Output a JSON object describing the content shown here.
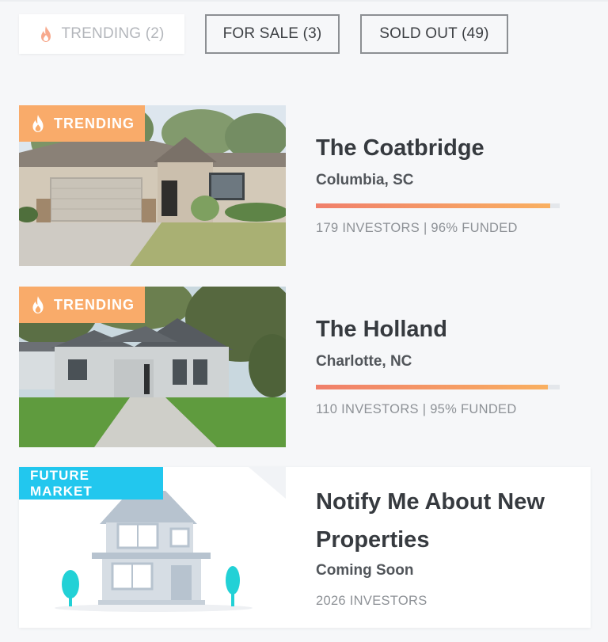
{
  "tabs": [
    {
      "label": "TRENDING (2)",
      "icon": "flame-icon",
      "active": true
    },
    {
      "label": "FOR SALE (3)",
      "active": false
    },
    {
      "label": "SOLD OUT (49)",
      "active": false
    }
  ],
  "properties": [
    {
      "badge": "TRENDING",
      "badge_icon": "flame-icon",
      "name": "The Coatbridge",
      "location": "Columbia, SC",
      "funded_fraction": 0.96,
      "stats": "179 INVESTORS | 96% FUNDED"
    },
    {
      "badge": "TRENDING",
      "badge_icon": "flame-icon",
      "name": "The Holland",
      "location": "Charlotte, NC",
      "funded_fraction": 0.95,
      "stats": "110 INVESTORS | 95% FUNDED"
    }
  ],
  "future": {
    "badge": "FUTURE MARKET",
    "title_line1": "Notify Me About New",
    "title_line2": "Properties",
    "subtitle": "Coming Soon",
    "stats": "2026 INVESTORS"
  },
  "colors": {
    "trending_badge": "#f9ab6a",
    "future_badge": "#22c7ee",
    "progress_start": "#f07f6b",
    "progress_end": "#f9b061"
  }
}
